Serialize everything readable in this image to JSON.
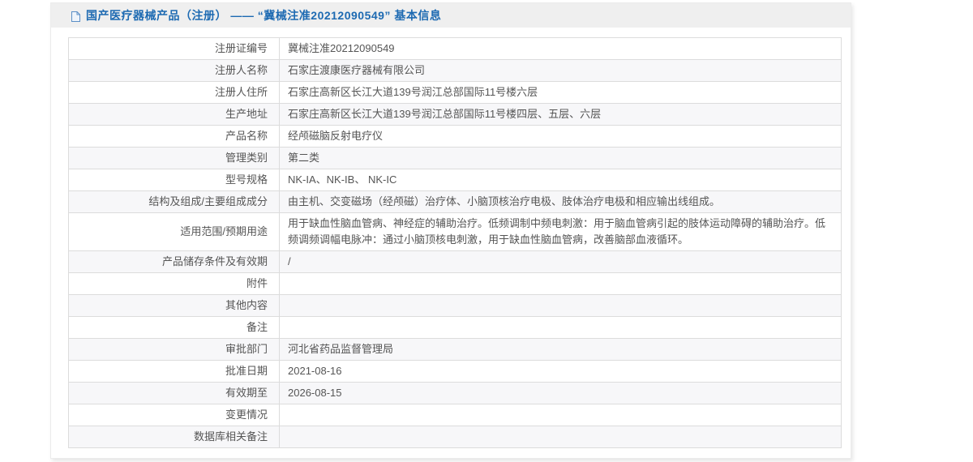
{
  "header": {
    "title": "国产医疗器械产品（注册） —— “冀械注准20212090549” 基本信息",
    "icon": "document-icon"
  },
  "colors": {
    "title_blue": "#1d6ab2",
    "header_strip_bg": "#efefef",
    "row_stripe": "#f7f7f9",
    "table_border": "#dcdcdc"
  },
  "table": {
    "rows": [
      {
        "label": "注册证编号",
        "value": "冀械注准20212090549"
      },
      {
        "label": "注册人名称",
        "value": "石家庄渡康医疗器械有限公司"
      },
      {
        "label": "注册人住所",
        "value": "石家庄高新区长江大道139号润江总部国际11号楼六层"
      },
      {
        "label": "生产地址",
        "value": "石家庄高新区长江大道139号润江总部国际11号楼四层、五层、六层"
      },
      {
        "label": "产品名称",
        "value": "经颅磁脑反射电疗仪"
      },
      {
        "label": "管理类别",
        "value": "第二类"
      },
      {
        "label": "型号规格",
        "value": "NK-IA、NK-IB、 NK-IC"
      },
      {
        "label": "结构及组成/主要组成成分",
        "value": "由主机、交变磁场（经颅磁）治疗体、小脑顶核治疗电极、肢体治疗电极和相应输出线组成。"
      },
      {
        "label": "适用范围/预期用途",
        "value": "用于缺血性脑血管病、神经症的辅助治疗。低频调制中频电刺激：用于脑血管病引起的肢体运动障碍的辅助治疗。低频调频调幅电脉冲：通过小脑顶核电刺激，用于缺血性脑血管病，改善脑部血液循环。"
      },
      {
        "label": "产品储存条件及有效期",
        "value": "/"
      },
      {
        "label": "附件",
        "value": ""
      },
      {
        "label": "其他内容",
        "value": ""
      },
      {
        "label": "备注",
        "value": ""
      },
      {
        "label": "审批部门",
        "value": "河北省药品监督管理局"
      },
      {
        "label": "批准日期",
        "value": "2021-08-16"
      },
      {
        "label": "有效期至",
        "value": "2026-08-15"
      },
      {
        "label": "变更情况",
        "value": ""
      },
      {
        "label": "数据库相关备注",
        "value": ""
      }
    ]
  }
}
